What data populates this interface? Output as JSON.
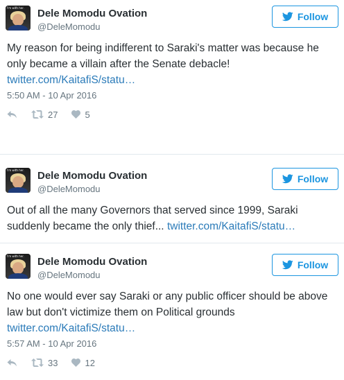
{
  "tweets": [
    {
      "name": "Dele Momodu Ovation",
      "handle": "@DeleMomodu",
      "follow_label": "Follow",
      "avatar_caption": "I'm with her.",
      "text_line1": "My reason for being indifferent to Saraki's matter was because he",
      "text_line2": "only became a villain after the Senate debacle!",
      "link": "twitter.com/KaitafiS/statu…",
      "timestamp": "5:50 AM - 10 Apr 2016",
      "retweets": "27",
      "likes": "5"
    },
    {
      "name": "Dele Momodu Ovation",
      "handle": "@DeleMomodu",
      "follow_label": "Follow",
      "avatar_caption": "I'm with her.",
      "text_line1": "Out of all the many Governors that served since 1999, Saraki",
      "text_line2": "suddenly became the only thief...",
      "link": "twitter.com/KaitafiS/statu…"
    },
    {
      "name": "Dele Momodu Ovation",
      "handle": "@DeleMomodu",
      "follow_label": "Follow",
      "avatar_caption": "I'm with her.",
      "text_line1": "No one would ever say Saraki or any public officer should be above",
      "text_line2": "law but don't victimize them on Political grounds",
      "link": "twitter.com/KaitafiS/statu…",
      "timestamp": "5:57 AM - 10 Apr 2016",
      "retweets": "33",
      "likes": "12"
    }
  ],
  "icons": {
    "twitter": "twitter-bird-icon",
    "reply": "reply-icon",
    "retweet": "retweet-icon",
    "like": "heart-icon"
  },
  "colors": {
    "link": "#2b7bb9",
    "follow": "#1b95e0",
    "muted": "#66757f",
    "action_icon": "#aab8c2"
  }
}
